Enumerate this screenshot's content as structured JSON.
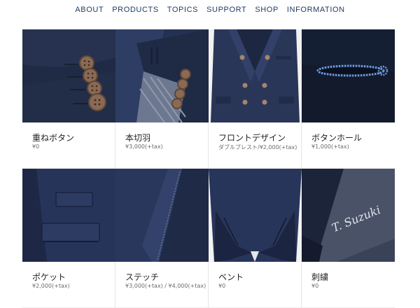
{
  "nav": {
    "items": [
      "ABOUT",
      "PRODUCTS",
      "TOPICS",
      "SUPPORT",
      "SHOP",
      "INFORMATION"
    ]
  },
  "products": [
    {
      "title": "重ねボタン",
      "price": "¥0",
      "image": "sleeve-stacked-buttons-photo"
    },
    {
      "title": "本切羽",
      "price": "¥3,000(+tax)",
      "image": "sleeve-working-cuff-photo"
    },
    {
      "title": "フロントデザイン",
      "price": "ダブルブレスト/¥2,000(+tax)",
      "image": "double-breasted-front-photo"
    },
    {
      "title": "ボタンホール",
      "price": "¥1,000(+tax)",
      "image": "blue-buttonhole-stitch-photo"
    },
    {
      "title": "ポケット",
      "price": "¥2,000(+tax)",
      "image": "pocket-flap-photo"
    },
    {
      "title": "ステッチ",
      "price": "¥3,000(+tax) / ¥4,000(+tax)",
      "image": "lapel-stitch-photo"
    },
    {
      "title": "ベント",
      "price": "¥0",
      "image": "back-vent-photo"
    },
    {
      "title": "刺繍",
      "price": "¥0",
      "image": "lining-embroidery-photo"
    }
  ],
  "embroidery_text": "T. Suzuki",
  "colors": {
    "navy_dark": "#1f2a44",
    "navy": "#2c3a5c",
    "navy_light": "#3d4c70",
    "button_brown": "#8a6a55",
    "buttonhole_blue": "#6a9be0",
    "nav_text": "#1e3a5f"
  }
}
